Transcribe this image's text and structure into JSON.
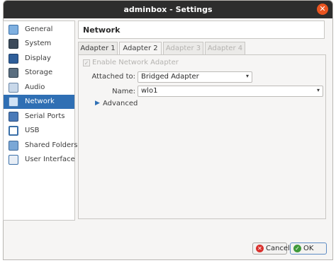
{
  "window": {
    "title": "adminbox - Settings",
    "close_glyph": "✕"
  },
  "sidebar": {
    "items": [
      {
        "label": "General",
        "icon": "general-icon"
      },
      {
        "label": "System",
        "icon": "system-icon"
      },
      {
        "label": "Display",
        "icon": "display-icon"
      },
      {
        "label": "Storage",
        "icon": "storage-icon"
      },
      {
        "label": "Audio",
        "icon": "audio-icon"
      },
      {
        "label": "Network",
        "icon": "network-icon",
        "selected": true
      },
      {
        "label": "Serial Ports",
        "icon": "serial-ports-icon"
      },
      {
        "label": "USB",
        "icon": "usb-icon"
      },
      {
        "label": "Shared Folders",
        "icon": "shared-folders-icon"
      },
      {
        "label": "User Interface",
        "icon": "user-interface-icon"
      }
    ]
  },
  "panel": {
    "title": "Network"
  },
  "tabs": [
    {
      "label": "Adapter 1",
      "state": "normal"
    },
    {
      "label": "Adapter 2",
      "state": "active"
    },
    {
      "label": "Adapter 3",
      "state": "disabled"
    },
    {
      "label": "Adapter 4",
      "state": "disabled"
    }
  ],
  "adapter": {
    "enable_label": "Enable Network Adapter",
    "enable_checked": true,
    "enable_disabled": true,
    "attached_label": "Attached to:",
    "attached_value": "Bridged Adapter",
    "name_label": "Name:",
    "name_value": "wlo1",
    "advanced_label": "Advanced"
  },
  "buttons": {
    "cancel": "Cancel",
    "ok": "OK"
  },
  "colors": {
    "selection": "#2f6fb4",
    "titlebar": "#2d2d2d",
    "close": "#e95420"
  }
}
